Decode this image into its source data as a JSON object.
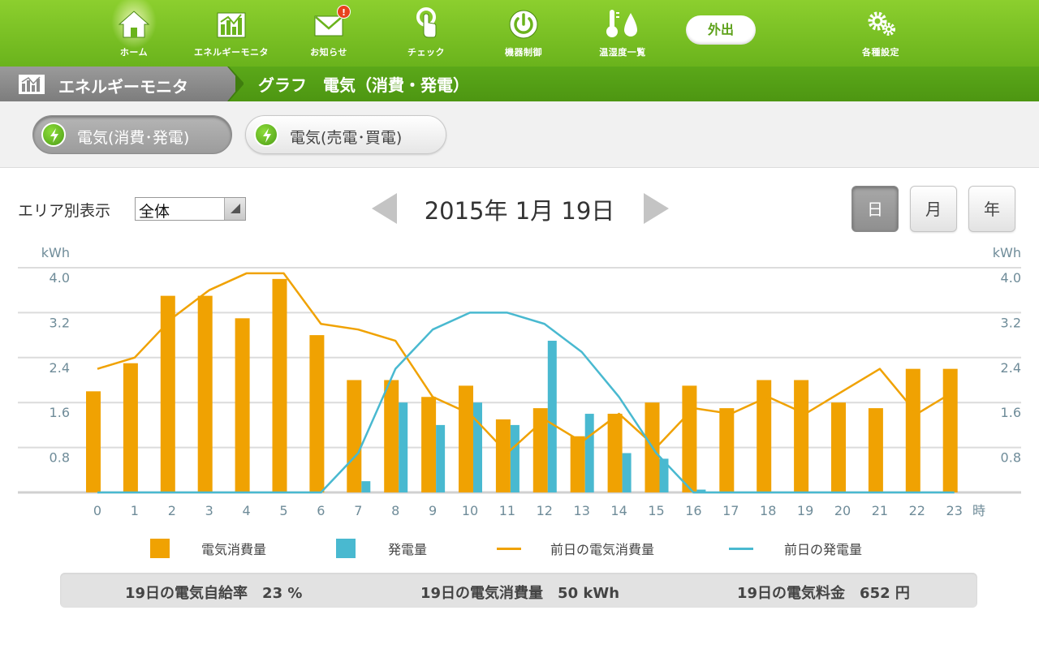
{
  "nav": {
    "items": [
      {
        "label": "ホーム",
        "icon": "home-icon"
      },
      {
        "label": "エネルギーモニタ",
        "icon": "chart-icon"
      },
      {
        "label": "お知らせ",
        "icon": "mail-icon",
        "badge": "!"
      },
      {
        "label": "チェック",
        "icon": "touch-check-icon"
      },
      {
        "label": "機器制御",
        "icon": "power-icon"
      },
      {
        "label": "温湿度一覧",
        "icon": "thermo-humidity-icon"
      },
      {
        "label": "各種設定",
        "icon": "gear-icon"
      }
    ],
    "go_out_label": "外出"
  },
  "breadcrumb": {
    "section": "エネルギーモニタ",
    "current": "グラフ　電気（消費・発電）"
  },
  "subtabs": {
    "active": "電気(消費･発電)",
    "inactive": "電気(売電･買電)"
  },
  "controls": {
    "area_label": "エリア別表示",
    "area_value": "全体",
    "date": "2015年 1月 19日",
    "period_day": "日",
    "period_month": "月",
    "period_year": "年"
  },
  "chart_data": {
    "type": "bar",
    "ylabel_left": "kWh",
    "ylabel_right": "kWh",
    "x_unit": "時",
    "ylim": [
      0,
      4.0
    ],
    "yticks": [
      "0.8",
      "1.6",
      "2.4",
      "3.2",
      "4.0"
    ],
    "yticks_values": [
      0.8,
      1.6,
      2.4,
      3.2,
      4.0
    ],
    "categories": [
      "0",
      "1",
      "2",
      "3",
      "4",
      "5",
      "6",
      "7",
      "8",
      "9",
      "10",
      "11",
      "12",
      "13",
      "14",
      "15",
      "16",
      "17",
      "18",
      "19",
      "20",
      "21",
      "22",
      "23"
    ],
    "series": [
      {
        "name": "電気消費量",
        "kind": "bar",
        "color": "#f0a202",
        "values": [
          1.8,
          2.3,
          3.5,
          3.5,
          3.1,
          3.8,
          2.8,
          2.0,
          2.0,
          1.7,
          1.9,
          1.3,
          1.5,
          1.0,
          1.4,
          1.6,
          1.9,
          1.5,
          2.0,
          2.0,
          1.6,
          1.5,
          2.2,
          2.2
        ]
      },
      {
        "name": "発電量",
        "kind": "bar",
        "color": "#49b9d0",
        "values": [
          0,
          0,
          0,
          0,
          0,
          0,
          0,
          0.2,
          1.6,
          1.2,
          1.6,
          1.2,
          2.7,
          1.4,
          0.7,
          0.6,
          0.05,
          0,
          0,
          0,
          0,
          0,
          0,
          0
        ]
      },
      {
        "name": "前日の電気消費量",
        "kind": "line",
        "color": "#f0a202",
        "values": [
          2.2,
          2.4,
          3.1,
          3.6,
          3.9,
          3.9,
          3.0,
          2.9,
          2.7,
          1.7,
          1.4,
          0.7,
          1.3,
          0.9,
          1.4,
          0.8,
          1.5,
          1.4,
          1.7,
          1.4,
          1.8,
          2.2,
          1.4,
          1.8
        ]
      },
      {
        "name": "前日の発電量",
        "kind": "line",
        "color": "#49b9d0",
        "values": [
          0,
          0,
          0,
          0,
          0,
          0,
          0,
          0.7,
          2.2,
          2.9,
          3.2,
          3.2,
          3.0,
          2.5,
          1.7,
          0.7,
          0,
          0,
          0,
          0,
          0,
          0,
          0,
          0
        ]
      }
    ]
  },
  "summary": {
    "self_sufficiency": "19日の電気自給率　23 %",
    "consumption": "19日の電気消費量　50 kWh",
    "fee": "19日の電気料金　652 円"
  },
  "colors": {
    "nav_green": "#7bc224",
    "consumption": "#f0a202",
    "generation": "#49b9d0"
  }
}
